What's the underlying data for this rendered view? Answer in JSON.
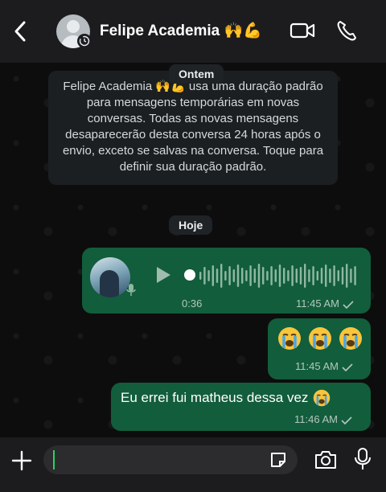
{
  "header": {
    "contact_name": "Felipe Academia 🙌💪",
    "icons": [
      "back-chevron-icon",
      "avatar-placeholder",
      "timer-icon",
      "video-call-icon",
      "phone-icon"
    ]
  },
  "chat": {
    "date_ontem": "Ontem",
    "system_message": "Felipe Academia 🙌💪 usa uma duração padrão para mensagens temporárias em novas conversas. Todas as novas mensagens desaparecerão desta conversa 24 horas após o envio, exceto se salvas na conversa. Toque para definir sua duração padrão.",
    "date_hoje": "Hoje",
    "messages": [
      {
        "type": "audio",
        "duration": "0:36",
        "time": "11:45 AM"
      },
      {
        "type": "emoji",
        "content": "😭😭😭",
        "time": "11:45 AM"
      },
      {
        "type": "text",
        "content": "Eu errei fui matheus dessa vez",
        "time": "11:46 AM"
      }
    ]
  },
  "input": {
    "icons": [
      "plus-icon",
      "sticker-icon",
      "camera-icon",
      "microphone-icon"
    ]
  },
  "colors": {
    "outgoing_bubble": "#125d3c",
    "header_bg": "#1c1c1e",
    "accent": "#25d366"
  }
}
